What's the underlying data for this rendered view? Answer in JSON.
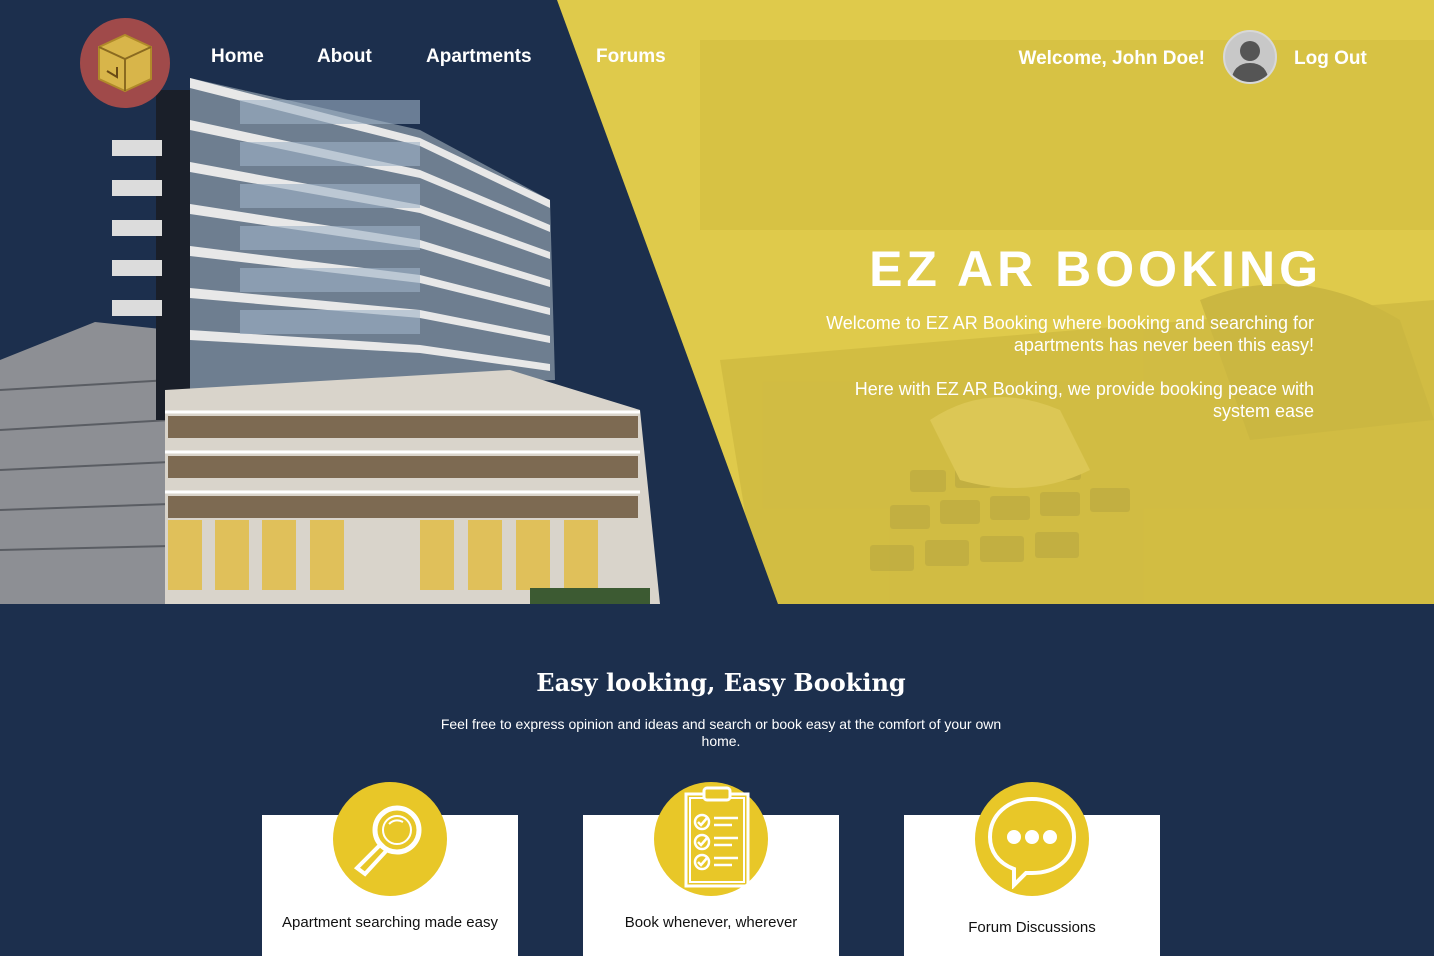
{
  "nav": {
    "items": [
      {
        "label": "Home"
      },
      {
        "label": "About"
      },
      {
        "label": "Apartments"
      },
      {
        "label": "Forums"
      }
    ],
    "welcome": "Welcome, John Doe!",
    "logout": "Log Out"
  },
  "hero": {
    "title": "EZ AR BOOKING",
    "paragraph1": "Welcome to EZ AR Booking where booking and searching for apartments has never been this easy!",
    "paragraph2": "Here with EZ AR Booking, we provide booking peace with system ease"
  },
  "features": {
    "title": "Easy looking, Easy Booking",
    "subtitle": "Feel free to express opinion and ideas and search or book easy at the comfort of your own home.",
    "cards": [
      {
        "label": "Apartment searching made easy",
        "icon": "magnifier-icon"
      },
      {
        "label": "Book whenever, wherever",
        "icon": "clipboard-checklist-icon"
      },
      {
        "label": "Forum Discussions",
        "icon": "chat-bubble-icon"
      }
    ]
  },
  "colors": {
    "navy": "#1c2f4d",
    "yellow": "#dfca4b",
    "accent_yellow": "#e8c728",
    "logo_bg": "#a04a4a"
  }
}
